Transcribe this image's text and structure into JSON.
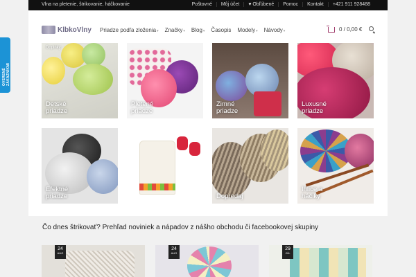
{
  "topbar": {
    "tagline": "Vlna na pletenie, štrikovanie, háčkovanie",
    "links": [
      "Poštovné",
      "Môj účet",
      "♥ Obľúbené",
      "Pomoc",
      "Kontakt",
      "+421 911 928488"
    ]
  },
  "side_tab": {
    "label": "OVERENÉ ZÁKAZNÍKMI"
  },
  "header": {
    "logo_text": "KlbkoVlny",
    "nav": [
      "Priadze podľa zloženia",
      "Značky",
      "Blog",
      "Časopis",
      "Modely",
      "Návody"
    ],
    "cart_text": "0 / 0,00 €"
  },
  "tiles": [
    {
      "label": "Detské\npriadze",
      "tag": "Doplnky"
    },
    {
      "label": "Pletené\npriadze",
      "tag": ""
    },
    {
      "label": "Zimné\npriadze",
      "tag": ""
    },
    {
      "label": "Luxusné\npriadze",
      "tag": ""
    },
    {
      "label": "Efektné\npriadze",
      "tag": ""
    },
    {
      "label": "",
      "tag": ""
    },
    {
      "label": "Dopredaj",
      "tag": ""
    },
    {
      "label": "Ihlice a\nháčiky",
      "tag": ""
    }
  ],
  "section": {
    "title": "Čo dnes štrikovať? Prehľad noviniek a nápadov z nášho obchodu či facebookovej skupiny"
  },
  "posts": [
    {
      "day": "24",
      "month": "AUG"
    },
    {
      "day": "24",
      "month": "AUG"
    },
    {
      "day": "29",
      "month": "JÚL"
    }
  ]
}
